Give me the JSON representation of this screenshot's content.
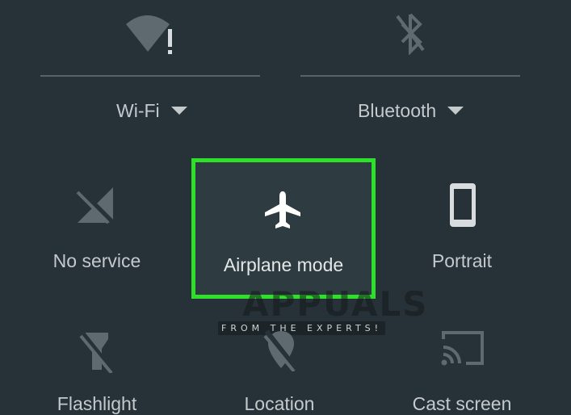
{
  "row1": {
    "wifi_label": "Wi-Fi",
    "bluetooth_label": "Bluetooth"
  },
  "row2": {
    "no_service_label": "No service",
    "airplane_label": "Airplane mode",
    "portrait_label": "Portrait"
  },
  "row3": {
    "flashlight_label": "Flashlight",
    "location_label": "Location",
    "cast_label": "Cast screen"
  },
  "watermark": {
    "brand": "APPUALS",
    "tagline": "FROM THE EXPERTS!"
  },
  "colors": {
    "background": "#263238",
    "highlight_border": "#2fe02a",
    "icon_dim": "#5e6a70",
    "icon_active": "#ffffff"
  }
}
